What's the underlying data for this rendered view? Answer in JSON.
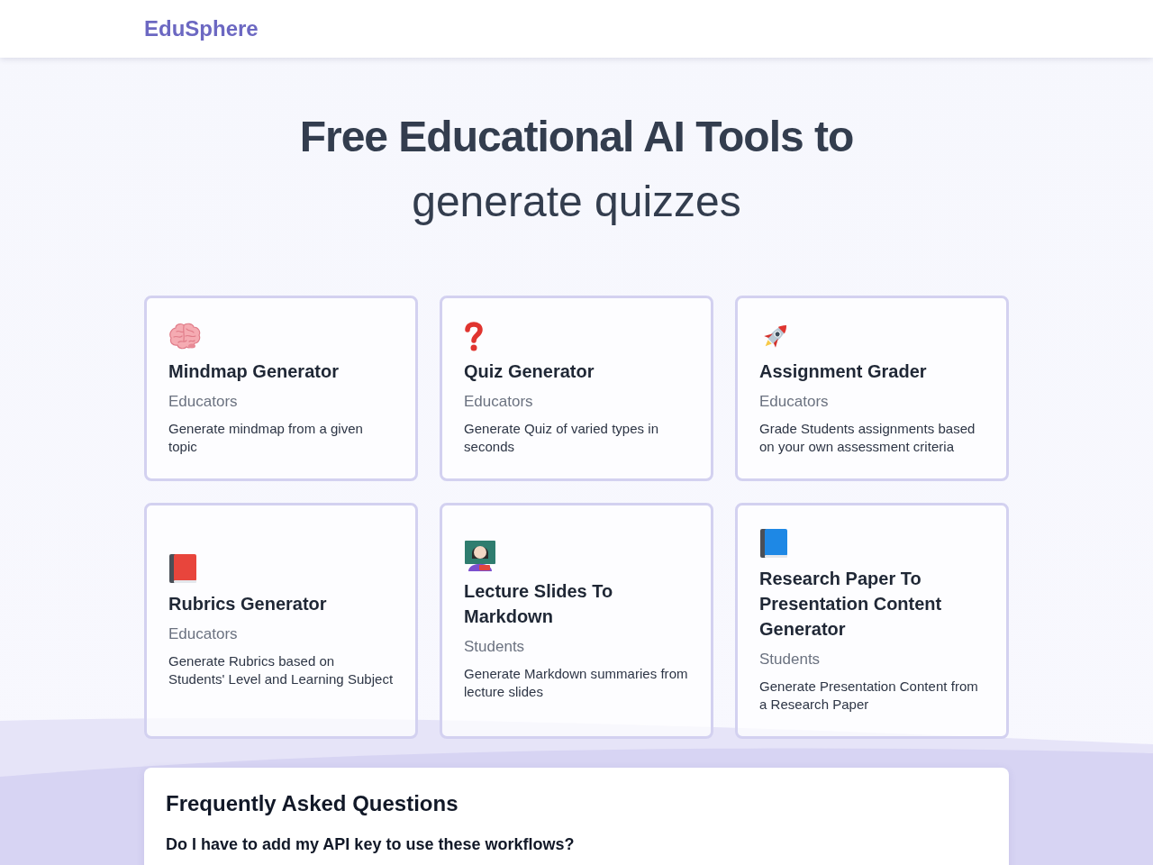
{
  "header": {
    "logo": "EduSphere"
  },
  "hero": {
    "title": "Free Educational AI Tools to",
    "subtitle": "generate quizzes"
  },
  "tools": [
    {
      "kind": "brain",
      "title": "Mindmap Generator",
      "audience": "Educators",
      "description": "Generate mindmap from a given topic"
    },
    {
      "kind": "question",
      "title": "Quiz Generator",
      "audience": "Educators",
      "description": "Generate Quiz of varied types in seconds"
    },
    {
      "kind": "rocket",
      "title": "Assignment Grader",
      "audience": "Educators",
      "description": "Grade Students assignments based on your own assessment criteria"
    },
    {
      "kind": "book",
      "color": "#e8453c",
      "title": "Rubrics Generator",
      "audience": "Educators",
      "description": "Generate Rubrics based on Students' Level and Learning Subject"
    },
    {
      "kind": "teacher",
      "title": "Lecture Slides To Markdown",
      "audience": "Students",
      "description": "Generate Markdown summaries from lecture slides"
    },
    {
      "kind": "book",
      "color": "#1e88e5",
      "title": "Research Paper To Presentation Content Generator",
      "audience": "Students",
      "description": "Generate Presentation Content from a Research Paper"
    }
  ],
  "faq": {
    "title": "Frequently Asked Questions",
    "items": [
      {
        "question": "Do I have to add my API key to use these workflows?"
      }
    ]
  }
}
